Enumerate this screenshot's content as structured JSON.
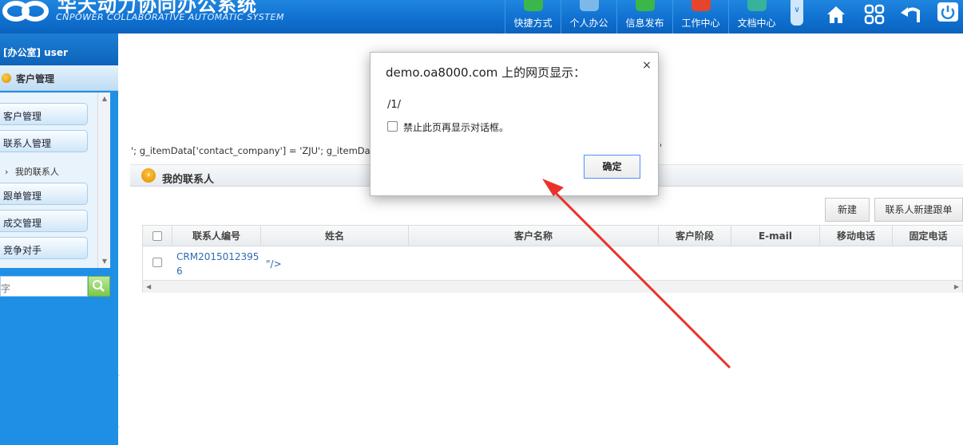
{
  "header": {
    "title": "华天动力协同办公系统",
    "subtitle": "CNPOWER COLLABORATIVE AUTOMATIC SYSTEM",
    "nav": [
      {
        "label": "快捷方式",
        "icon": "paper-plane-icon"
      },
      {
        "label": "个人办公",
        "icon": "person-icon"
      },
      {
        "label": "信息发布",
        "icon": "chat-bubble-icon"
      },
      {
        "label": "工作中心",
        "icon": "star-icon"
      },
      {
        "label": "文档中心",
        "icon": "document-icon"
      }
    ],
    "scroll_glyph": "∨",
    "tools": [
      "home-icon",
      "apps-grid-icon",
      "back-arrow-icon",
      "power-icon"
    ]
  },
  "sidebar": {
    "user": "[办公室] user",
    "category": "客户管理",
    "items": [
      {
        "label": "客户管理"
      },
      {
        "label": "联系人管理"
      },
      {
        "label": "我的联系人",
        "sub": true,
        "glyph": "›"
      },
      {
        "label": "跟单管理"
      },
      {
        "label": "成交管理"
      },
      {
        "label": "竞争对手"
      }
    ],
    "search_placeholder": "字",
    "collapse_glyph": "‹"
  },
  "main": {
    "leaked_script": "'; g_itemData['contact_company'] = 'ZJU'; g_itemData",
    "leaked_tail": "'",
    "section_title": "我的联系人",
    "buttons": {
      "new": "新建",
      "new_followup": "联系人新建跟单"
    },
    "columns": [
      "联系人编号",
      "姓名",
      "客户名称",
      "客户阶段",
      "E-mail",
      "移动电话",
      "固定电话"
    ],
    "rows": [
      {
        "id_line1": "CRM2015012395",
        "id_line2": "6",
        "name": "\"/>"
      }
    ]
  },
  "dialog": {
    "title": "demo.oa8000.com 上的网页显示：",
    "message": "/1/",
    "checkbox_label": "禁止此页再显示对话框。",
    "ok": "确定",
    "close": "×"
  },
  "colors": {
    "header_blue": "#0f6fcf",
    "sidebar_blue": "#1f8fe6",
    "link": "#2d6bb0",
    "annotation_arrow": "#e8332a"
  }
}
